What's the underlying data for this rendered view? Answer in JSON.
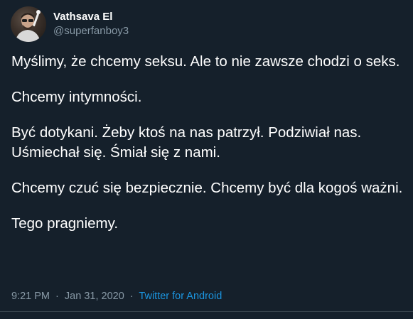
{
  "author": {
    "display_name": "Vathsava El",
    "handle": "@superfanboy3",
    "avatar_icon": "user-avatar-photo"
  },
  "tweet": {
    "paragraphs": [
      "Myślimy, że chcemy seksu. Ale to nie zawsze chodzi o seks.",
      "Chcemy intymności.",
      "Być dotykani. Żeby ktoś na nas patrzył. Podziwiał nas. Uśmiechał się. Śmiał się z nami.",
      "Chcemy czuć się bezpiecznie. Chcemy być dla kogoś ważni.",
      "Tego pragniemy."
    ]
  },
  "meta": {
    "time": "9:21 PM",
    "separator": "·",
    "date": "Jan 31, 2020",
    "source": "Twitter for Android"
  },
  "colors": {
    "background": "#15202b",
    "secondary_text": "#8899a6",
    "link": "#1b95e0"
  }
}
